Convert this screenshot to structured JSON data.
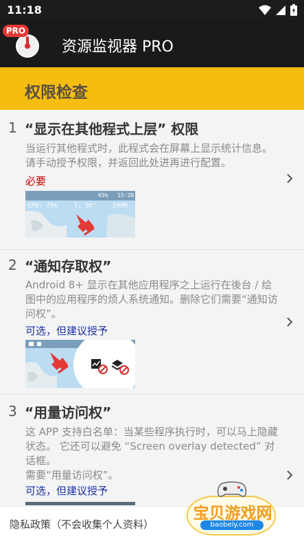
{
  "status_bar": {
    "time": "11:18"
  },
  "app": {
    "badge": "PRO",
    "title": "资源监视器 PRO"
  },
  "section": {
    "title": "权限检查"
  },
  "items": [
    {
      "number": "1",
      "title": "“显示在其他程式上层” 权限",
      "description": "当运行其他程式时，此程式会在屏幕上显示统计信息。请手动授予权限，并返回此处进再进行配置。",
      "status": "必要",
      "preview": {
        "battery": "65%",
        "clock": "15:20",
        "cpu": "CPU: 75%",
        "temp": "T: 36°",
        "mem": "599M"
      }
    },
    {
      "number": "2",
      "title": "“通知存取权”",
      "description": "Android 8+ 显示在其他应用程序之上运行在後台 / 绘图中的应用程序的烦人系统通知。删除它们需要“通知访问权”。",
      "status": "可选，但建议授予"
    },
    {
      "number": "3",
      "title": "“用量访问权”",
      "description": "这 APP 支持白名单：当某些程序执行时，可以马上隐藏状态。 它还可以避免 “Screen overlay detected” 对话框。\n需要“用量访问权”。",
      "status": "可选，但建议授予"
    }
  ],
  "footer": {
    "privacy": "隐私政策（不会收集个人资料）"
  },
  "watermark": {
    "brand": "宝贝游戏网",
    "url": "baobeiy.com"
  },
  "colors": {
    "accent": "#f5bd10",
    "required": "#cc0000",
    "optional": "#1c2fa8"
  }
}
